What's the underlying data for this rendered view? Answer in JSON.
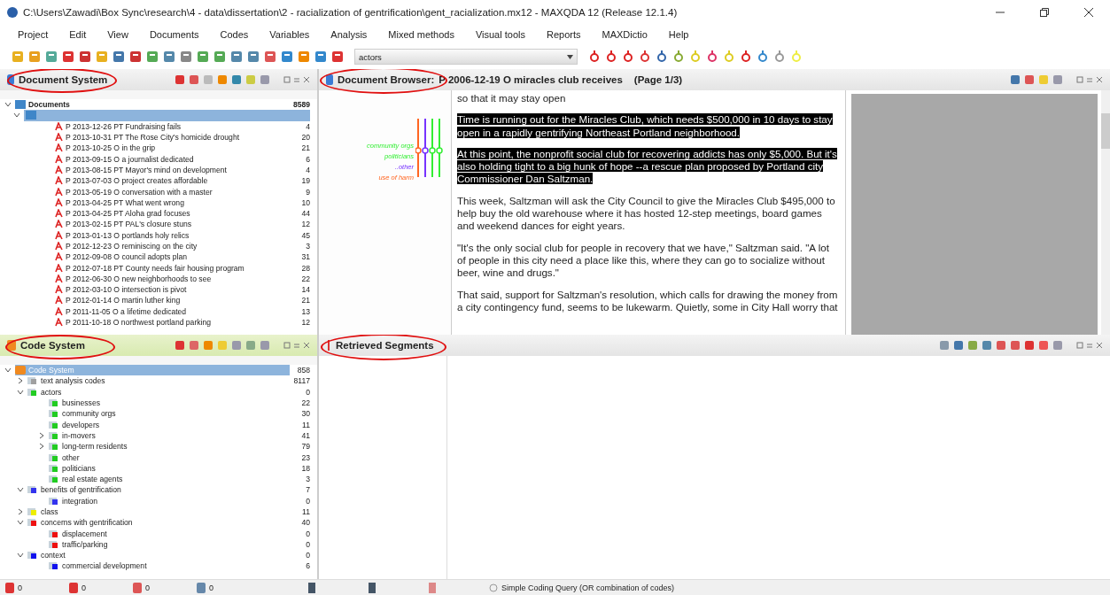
{
  "window": {
    "title": "C:\\Users\\Zawadi\\Box Sync\\research\\4 - data\\dissertation\\2 - racialization of gentrification\\gent_racialization.mx12 - MAXQDA 12  (Release 12.1.4)"
  },
  "menu": [
    "Project",
    "Edit",
    "View",
    "Documents",
    "Codes",
    "Variables",
    "Analysis",
    "Mixed methods",
    "Visual tools",
    "Reports",
    "MAXDictio",
    "Help"
  ],
  "toolbar": {
    "code_field": "actors"
  },
  "document_system": {
    "title": "Document System",
    "root": {
      "label": "Documents",
      "count": "8589",
      "expanded": true,
      "selected": false
    },
    "group": {
      "expanded": true,
      "selected": true
    },
    "documents": [
      {
        "label": "P 2013-12-26 PT Fundraising fails",
        "count": "4"
      },
      {
        "label": "P 2013-10-31 PT The Rose City's homicide drought",
        "count": "20"
      },
      {
        "label": "P 2013-10-25 O in the grip",
        "count": "21"
      },
      {
        "label": "P 2013-09-15 O a journalist dedicated",
        "count": "6"
      },
      {
        "label": "P 2013-08-15 PT Mayor's mind on development",
        "count": "4"
      },
      {
        "label": "P 2013-07-03 O project creates affordable",
        "count": "19"
      },
      {
        "label": "P 2013-05-19 O conversation with a master",
        "count": "9"
      },
      {
        "label": "P 2013-04-25 PT What went wrong",
        "count": "10"
      },
      {
        "label": "P 2013-04-25 PT Aloha grad focuses",
        "count": "44"
      },
      {
        "label": "P 2013-02-15 PT PAL's closure stuns",
        "count": "12"
      },
      {
        "label": "P 2013-01-13 O portlands holy relics",
        "count": "45"
      },
      {
        "label": "P 2012-12-23 O reminiscing on the city",
        "count": "3"
      },
      {
        "label": "P 2012-09-08 O council adopts plan",
        "count": "31"
      },
      {
        "label": "P 2012-07-18 PT County needs fair housing program",
        "count": "28"
      },
      {
        "label": "P 2012-06-30 O new neighborhoods to see",
        "count": "22"
      },
      {
        "label": "P 2012-03-10 O intersection is pivot",
        "count": "14"
      },
      {
        "label": "P 2012-01-14 O martin luther king",
        "count": "21"
      },
      {
        "label": "P 2011-11-05 O a lifetime dedicated",
        "count": "13"
      },
      {
        "label": "P 2011-10-18 O northwest portland parking",
        "count": "12"
      }
    ]
  },
  "code_system": {
    "title": "Code System",
    "root": {
      "label": "Code System",
      "count": "858",
      "expanded": true,
      "selected": true,
      "children": [
        {
          "label": "text analysis codes",
          "count": "8117",
          "color": "#a0a0a0",
          "expanded": false
        },
        {
          "label": "actors",
          "count": "0",
          "color": "#22cc22",
          "expanded": true,
          "children": [
            {
              "label": "businesses",
              "count": "22",
              "color": "#22cc22"
            },
            {
              "label": "community orgs",
              "count": "30",
              "color": "#22cc22"
            },
            {
              "label": "developers",
              "count": "11",
              "color": "#22cc22"
            },
            {
              "label": "in-movers",
              "count": "41",
              "color": "#22cc22",
              "expanded": false
            },
            {
              "label": "long-term residents",
              "count": "79",
              "color": "#22cc22",
              "expanded": false
            },
            {
              "label": "other",
              "count": "23",
              "color": "#22cc22"
            },
            {
              "label": "politicians",
              "count": "18",
              "color": "#22cc22"
            },
            {
              "label": "real estate agents",
              "count": "3",
              "color": "#22cc22"
            }
          ]
        },
        {
          "label": "benefits of gentrification",
          "count": "7",
          "color": "#3333ee",
          "expanded": true,
          "children": [
            {
              "label": "integration",
              "count": "0",
              "color": "#3333ee"
            }
          ]
        },
        {
          "label": "class",
          "count": "11",
          "color": "#eeee00",
          "expanded": false
        },
        {
          "label": "concerns with gentrification",
          "count": "40",
          "color": "#ee1111",
          "expanded": true,
          "children": [
            {
              "label": "displacement",
              "count": "0",
              "color": "#ee1111"
            },
            {
              "label": "traffic/parking",
              "count": "0",
              "color": "#ee1111"
            }
          ]
        },
        {
          "label": "context",
          "count": "0",
          "color": "#1111ee",
          "expanded": true,
          "children": [
            {
              "label": "commercial development",
              "count": "6",
              "color": "#1111ee"
            }
          ]
        }
      ]
    }
  },
  "document_browser": {
    "title": "Document Browser:",
    "document": "P 2006-12-19 O miracles club receives",
    "page": "(Page 1/3)",
    "margin_codes": [
      {
        "label": "community orgs",
        "color": "#33ee33"
      },
      {
        "label": "politicians",
        "color": "#33ee33"
      },
      {
        "label": "..other",
        "color": "#7733ff"
      },
      {
        "label": "use of harm",
        "color": "#ff6622"
      }
    ],
    "paragraphs": [
      {
        "text": "so that it may stay open",
        "highlighted": false
      },
      {
        "text": "Time is running out for the Miracles Club, which needs $500,000 in 10 days to stay open in a rapidly gentrifying Northeast Portland neighborhood.",
        "highlighted": true
      },
      {
        "text": "At this point, the nonprofit social club for recovering addicts has only $5,000. But it's also holding tight to a big hunk of hope --a rescue plan proposed by Portland city Commissioner Dan Saltzman.",
        "highlighted": true
      },
      {
        "text": "This week, Saltzman will ask the City Council to give the Miracles Club $495,000 to help buy the old warehouse where it has hosted 12-step meetings, board games and weekend dances for eight years.",
        "highlighted": false
      },
      {
        "text": "\"It's the only social club for people in recovery that we have,\" Saltzman said. \"A lot of people in this city need a place like this, where they can go to socialize without beer, wine and drugs.\"",
        "highlighted": false
      },
      {
        "text": "That said, support for Saltzman's resolution, which calls for drawing the money from a city contingency fund, seems to be lukewarm. Quietly, some in City Hall worry that",
        "highlighted": false
      }
    ]
  },
  "retrieved_segments": {
    "title": "Retrieved Segments"
  },
  "status_bar": {
    "counts": [
      "0",
      "0",
      "0",
      "0"
    ],
    "query": "Simple Coding Query (OR combination of codes)"
  }
}
